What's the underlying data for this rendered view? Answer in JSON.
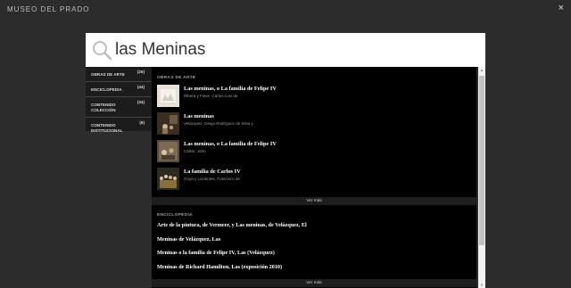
{
  "header": {
    "brand": "MUSEO DEL PRADO",
    "close_glyph": "×"
  },
  "search": {
    "value": "las Meninas",
    "placeholder": ""
  },
  "filters": [
    {
      "label": "OBRAS DE ARTE",
      "count": "(25)"
    },
    {
      "label": "ENCICLOPEDIA",
      "count": "(44)"
    },
    {
      "label": "CONTENIDO COLECCIÓN",
      "count": "(34)"
    },
    {
      "label": "CONTENIDO INSTITUCIONAL",
      "count": "(9)"
    }
  ],
  "artworks": {
    "section_title": "OBRAS DE ARTE",
    "items": [
      {
        "title": "Las meninas, o La familia de Felipe IV",
        "author": "Ribera y Fieve, Carlos Luis de"
      },
      {
        "title": "Las meninas",
        "author": "Velázquez, Diego Rodríguez de Silva y"
      },
      {
        "title": "Las meninas, o La familia de Felipe IV",
        "author": "Carter, John"
      },
      {
        "title": "La familia de Carlos IV",
        "author": "Goya y Lucientes, Francisco de"
      }
    ],
    "more_label": "Ver más"
  },
  "encyclopedia": {
    "section_title": "ENCICLOPEDIA",
    "items": [
      "Arte de la pintura, de Vermeer, y Las meninas, de Velázquez, El",
      "Meninas de Velázquez, Las",
      "Meninas o la familia de Felipe IV, Las (Velázquez)",
      "Meninas de Richard Hamilton, Las (exposición 2010)"
    ],
    "more_label": "Ver más"
  },
  "colors": {
    "background": "#2c2c2c",
    "results_bg": "#000000",
    "panel_bg": "#1c1c1c",
    "search_bg": "#ffffff"
  }
}
